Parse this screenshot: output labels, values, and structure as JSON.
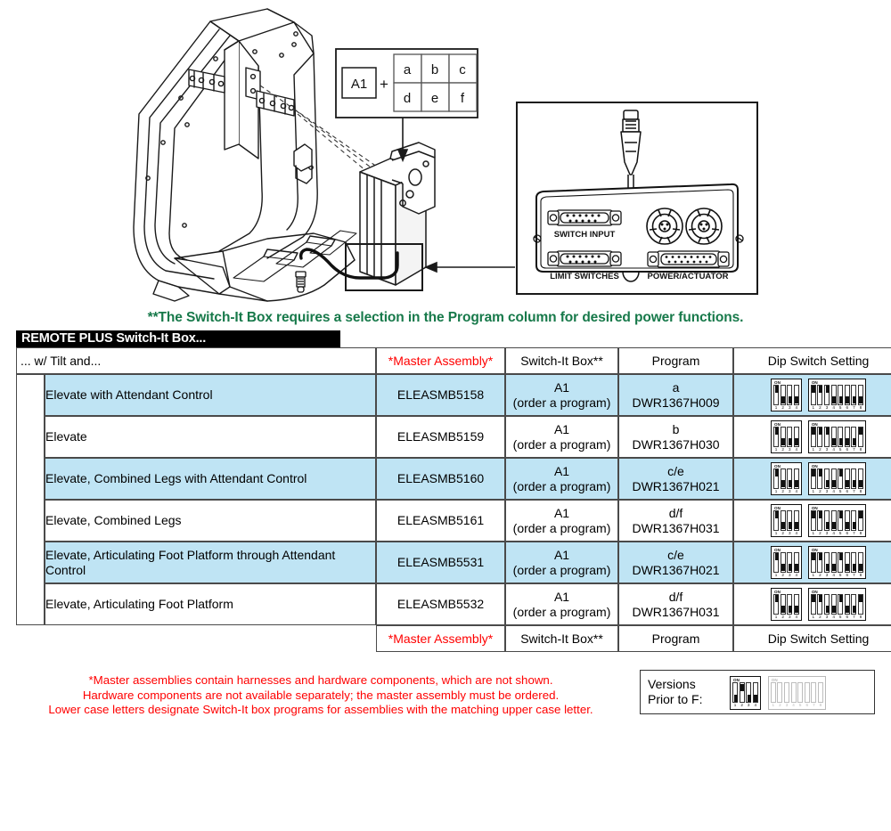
{
  "green_note": "**The Switch-It Box requires a selection in the Program column for desired power functions.",
  "banner": "REMOTE PLUS Switch-It Box...",
  "legend": {
    "code": "A1",
    "plus": "+",
    "letters": [
      "a",
      "b",
      "c",
      "d",
      "e",
      "f"
    ]
  },
  "panel_labels": {
    "switch_input": "SWITCH INPUT",
    "limit_switches": "LIMIT SWITCHES",
    "power_actuator": "POWER/ACTUATOR"
  },
  "columns": {
    "desc": "... w/ Tilt and...",
    "master": "*Master Assembly*",
    "box": "Switch-It Box**",
    "program": "Program",
    "dip": "Dip Switch Setting"
  },
  "rows": [
    {
      "desc": "Elevate with Attendant Control",
      "master": "ELEASMB5158",
      "box_code": "A1",
      "box_note": "(order a program)",
      "program_letter": "a",
      "program_code": "DWR1367H009",
      "highlight": true,
      "dip4": [
        "up",
        "down",
        "down",
        "down"
      ],
      "dip8": [
        "up",
        "up",
        "up",
        "down",
        "down",
        "down",
        "down",
        "down"
      ]
    },
    {
      "desc": "Elevate",
      "master": "ELEASMB5159",
      "box_code": "A1",
      "box_note": "(order a program)",
      "program_letter": "b",
      "program_code": "DWR1367H030",
      "highlight": false,
      "dip4": [
        "up",
        "down",
        "down",
        "down"
      ],
      "dip8": [
        "up",
        "up",
        "up",
        "down",
        "down",
        "down",
        "down",
        "up"
      ]
    },
    {
      "desc": "Elevate, Combined Legs with Attendant Control",
      "master": "ELEASMB5160",
      "box_code": "A1",
      "box_note": "(order a program)",
      "program_letter": "c/e",
      "program_code": "DWR1367H021",
      "highlight": true,
      "dip4": [
        "up",
        "down",
        "down",
        "down"
      ],
      "dip8": [
        "up",
        "up",
        "down",
        "down",
        "up",
        "down",
        "down",
        "down"
      ]
    },
    {
      "desc": "Elevate, Combined Legs",
      "master": "ELEASMB5161",
      "box_code": "A1",
      "box_note": "(order a program)",
      "program_letter": "d/f",
      "program_code": "DWR1367H031",
      "highlight": false,
      "dip4": [
        "up",
        "down",
        "down",
        "down"
      ],
      "dip8": [
        "up",
        "up",
        "down",
        "down",
        "up",
        "down",
        "down",
        "up"
      ]
    },
    {
      "desc": "Elevate, Articulating Foot Platform through Attendant Control",
      "master": "ELEASMB5531",
      "box_code": "A1",
      "box_note": "(order a program)",
      "program_letter": "c/e",
      "program_code": "DWR1367H021",
      "highlight": true,
      "dip4": [
        "up",
        "down",
        "down",
        "down"
      ],
      "dip8": [
        "up",
        "up",
        "down",
        "down",
        "up",
        "down",
        "down",
        "down"
      ]
    },
    {
      "desc": "Elevate, Articulating Foot Platform",
      "master": "ELEASMB5532",
      "box_code": "A1",
      "box_note": "(order a program)",
      "program_letter": "d/f",
      "program_code": "DWR1367H031",
      "highlight": false,
      "dip4": [
        "up",
        "down",
        "down",
        "down"
      ],
      "dip8": [
        "up",
        "up",
        "down",
        "down",
        "up",
        "down",
        "down",
        "up"
      ]
    }
  ],
  "footnotes": [
    "*Master assemblies contain harnesses and hardware components, which are not shown.",
    "Hardware components are not available separately; the master assembly must be ordered.",
    "Lower case letters designate Switch-It box programs for assemblies with the matching upper case letter."
  ],
  "versions": {
    "label_line1": "Versions",
    "label_line2": "Prior to F:",
    "dip4": [
      "down",
      "up",
      "down",
      "down"
    ],
    "dip8": [
      "none",
      "none",
      "none",
      "none",
      "none",
      "none",
      "none",
      "none"
    ]
  },
  "dip_on_label": "ON",
  "dip4_numbers": [
    "1",
    "2",
    "3",
    "4"
  ],
  "dip8_numbers": [
    "1",
    "2",
    "3",
    "4",
    "5",
    "6",
    "7",
    "8"
  ],
  "colors": {
    "green_note": "#17794a",
    "red_text": "#ff0000",
    "row_highlight": "#bfe4f4",
    "banner_bg": "#000000"
  }
}
